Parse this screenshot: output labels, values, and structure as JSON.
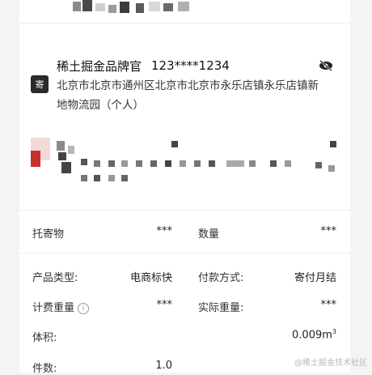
{
  "sender": {
    "badge": "寄",
    "name": "稀土掘金品牌官",
    "phone": "123****1234",
    "address_line1": "北京市北京市通州区北京市北京市永乐店镇永乐店镇新",
    "address_line2": "地物流园（个人）"
  },
  "cargo": {
    "item_label": "托寄物",
    "item_value": "***",
    "qty_label": "数量",
    "qty_value": "***"
  },
  "details": {
    "product_type_label": "产品类型:",
    "product_type_value": "电商标快",
    "payment_label": "付款方式:",
    "payment_value": "寄付月结",
    "billing_weight_label": "计费重量",
    "billing_weight_value": "***",
    "actual_weight_label": "实际重量:",
    "actual_weight_value": "***",
    "volume_label": "体积:",
    "volume_value": "0.009m",
    "volume_unit_sup": "3",
    "pieces_label": "件数:",
    "pieces_value": "1.0"
  },
  "watermark": "@稀土掘金技术社区",
  "colors": {
    "accent_red": "#c9302c",
    "text": "#222222"
  },
  "icons": {
    "visibility": "eye-slash-icon",
    "info": "info-icon"
  }
}
